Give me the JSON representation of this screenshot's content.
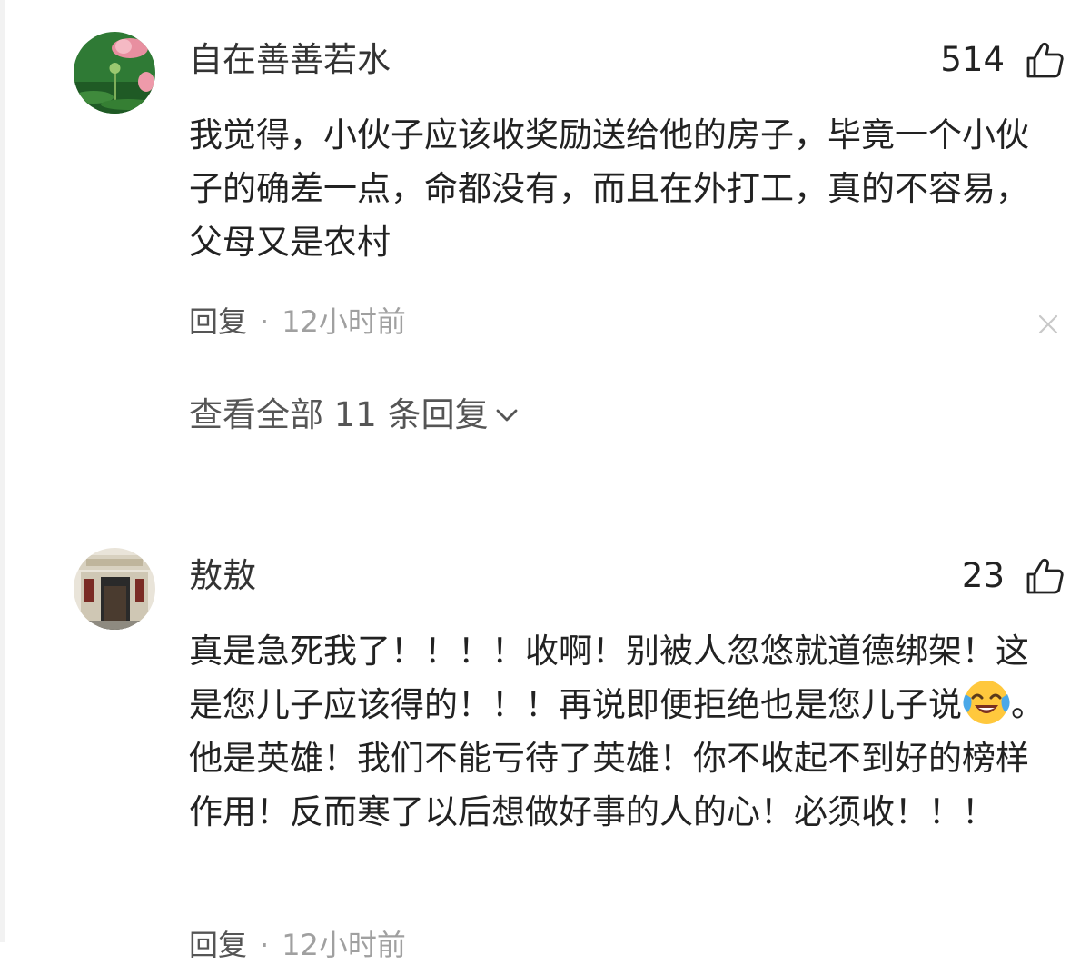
{
  "comments": [
    {
      "username": "自在善善若水",
      "likes": "514",
      "text": "我觉得，小伙子应该收奖励送给他的房子，毕竟一个小伙子的确差一点，命都没有，而且在外打工，真的不容易，父母又是农村",
      "reply_label": "回复",
      "separator": "·",
      "time": "12小时前",
      "view_all": "查看全部 11 条回复"
    },
    {
      "username": "敖敖",
      "likes": "23",
      "text_before_emoji": "真是急死我了！！！！收啊！别被人忽悠就道德绑架！这是您儿子应该得的！！！再说即便拒绝也是您儿子说",
      "emoji": "laughing-crying-emoji",
      "text_after_emoji": "。他是英雄！我们不能亏待了英雄！你不收起不到好的榜样作用！反而寒了以后想做好事的人的心！必须收！！！",
      "reply_label": "回复",
      "separator": "·",
      "time": "12小时前"
    }
  ],
  "colors": {
    "text": "#222222",
    "meta": "#a0a0a0",
    "link": "#555555"
  }
}
